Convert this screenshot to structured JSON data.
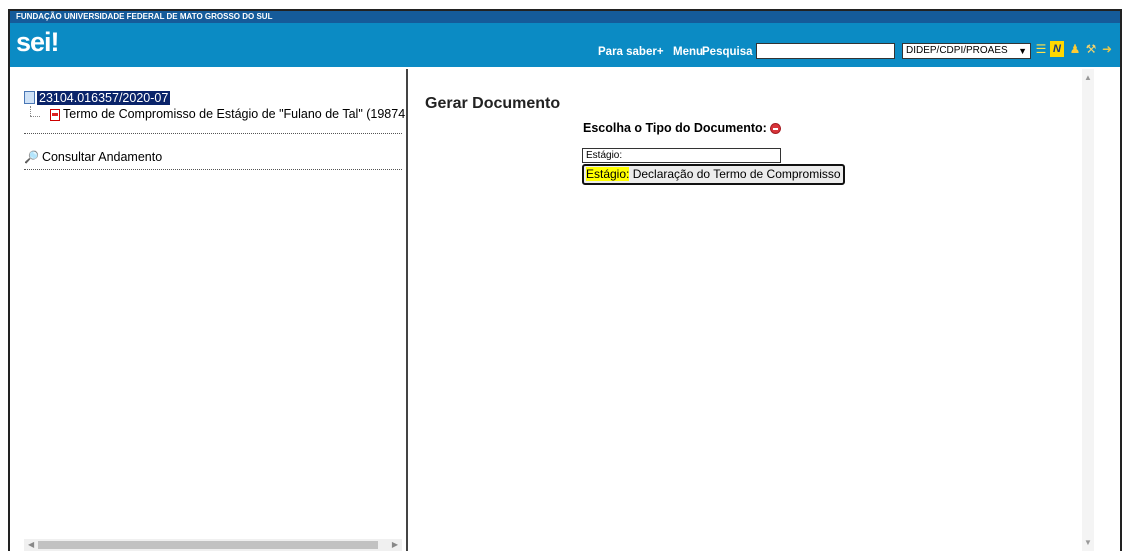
{
  "header": {
    "institution": "FUNDAÇÃO UNIVERSIDADE FEDERAL DE MATO GROSSO DO SUL",
    "logo": "sei!",
    "nav": {
      "para_saber": "Para saber+",
      "menu": "Menu",
      "pesquisa": "Pesquisa"
    },
    "search_value": "",
    "unit_selected": "DIDEP/CDPI/PROAES",
    "icons": [
      "list-icon",
      "notes-icon",
      "user-icon",
      "tools-icon",
      "exit-icon"
    ]
  },
  "tree": {
    "process_number": "23104.016357/2020-07",
    "document_label": "Termo de Compromisso de Estágio de \"Fulano de Tal\" (19874",
    "consult_label": "Consultar Andamento"
  },
  "main": {
    "title": "Gerar Documento",
    "choose_label": "Escolha o Tipo do Documento:",
    "filter_value": "Estágio:",
    "suggestion": {
      "highlight": "Estágio:",
      "rest": " Declaração do Termo de Compromisso"
    }
  },
  "colors": {
    "header_top": "#155b9a",
    "header_main": "#0b8bc4",
    "selection": "#0a246a",
    "highlight": "#ffff00"
  }
}
